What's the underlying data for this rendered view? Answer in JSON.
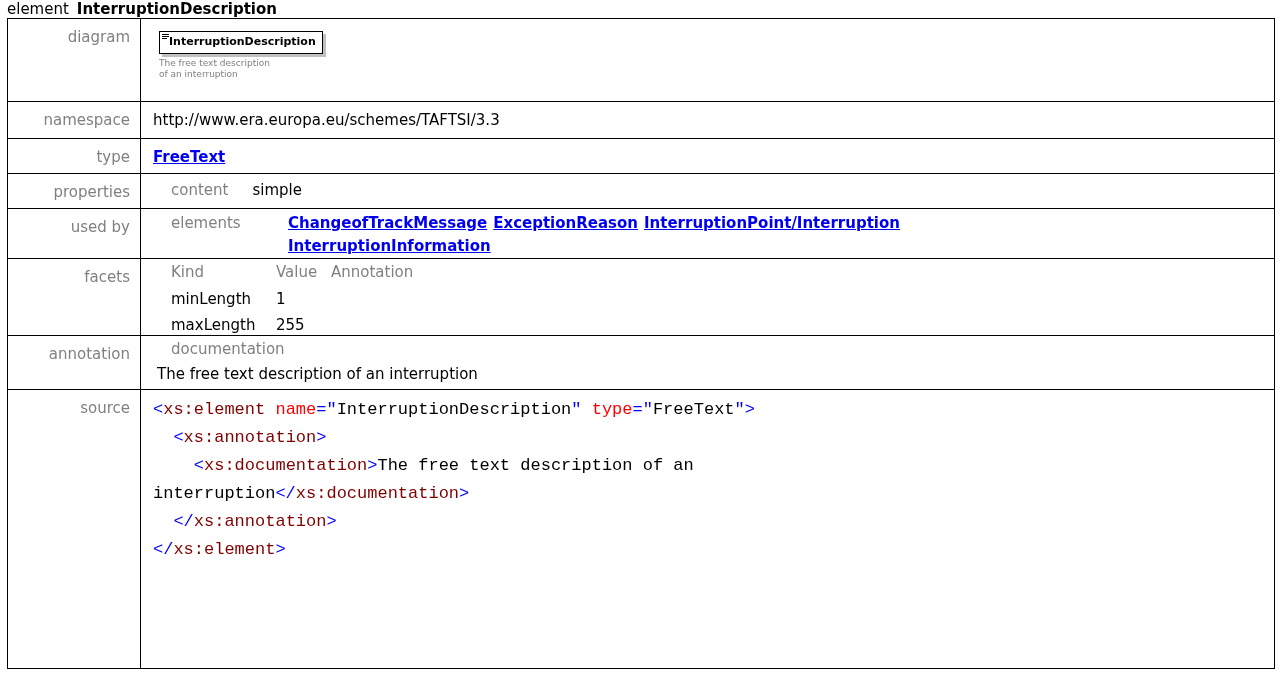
{
  "heading": {
    "prefix": "element",
    "name": "InterruptionDescription"
  },
  "diagram": {
    "label": "diagram",
    "element_name": "InterruptionDescription",
    "description": "The free text description of an interruption"
  },
  "namespace": {
    "label": "namespace",
    "value": "http://www.era.europa.eu/schemes/TAFTSI/3.3"
  },
  "type": {
    "label": "type",
    "link": "FreeText"
  },
  "properties": {
    "label": "properties",
    "key": "content",
    "value": "simple"
  },
  "used_by": {
    "label": "used by",
    "key": "elements",
    "links": [
      "ChangeofTrackMessage",
      "ExceptionReason",
      "InterruptionPoint/Interruption",
      "InterruptionInformation"
    ]
  },
  "facets": {
    "label": "facets",
    "columns": [
      "Kind",
      "Value",
      "Annotation"
    ],
    "rows": [
      {
        "kind": "minLength",
        "value": "1"
      },
      {
        "kind": "maxLength",
        "value": "255"
      }
    ]
  },
  "annotation": {
    "label": "annotation",
    "key": "documentation",
    "text": "The free text description of an interruption"
  },
  "source": {
    "label": "source",
    "lines": [
      [
        {
          "kind": "punct",
          "text": "<"
        },
        {
          "kind": "name",
          "text": "xs:element"
        },
        {
          "kind": "attr",
          "text": " name"
        },
        {
          "kind": "punct",
          "text": "=\""
        },
        {
          "kind": "text",
          "text": "InterruptionDescription"
        },
        {
          "kind": "punct",
          "text": "\""
        },
        {
          "kind": "attr",
          "text": " type"
        },
        {
          "kind": "punct",
          "text": "=\""
        },
        {
          "kind": "text",
          "text": "FreeText"
        },
        {
          "kind": "punct",
          "text": "\">"
        }
      ],
      [
        {
          "kind": "punct",
          "text": "  <"
        },
        {
          "kind": "name",
          "text": "xs:annotation"
        },
        {
          "kind": "punct",
          "text": ">"
        }
      ],
      [
        {
          "kind": "punct",
          "text": "    <"
        },
        {
          "kind": "name",
          "text": "xs:documentation"
        },
        {
          "kind": "punct",
          "text": ">"
        },
        {
          "kind": "text",
          "text": "The free text description of an"
        }
      ],
      [
        {
          "kind": "text",
          "text": "interruption"
        },
        {
          "kind": "punct",
          "text": "</"
        },
        {
          "kind": "name",
          "text": "xs:documentation"
        },
        {
          "kind": "punct",
          "text": ">"
        }
      ],
      [
        {
          "kind": "punct",
          "text": "  </"
        },
        {
          "kind": "name",
          "text": "xs:annotation"
        },
        {
          "kind": "punct",
          "text": ">"
        }
      ],
      [
        {
          "kind": "punct",
          "text": "</"
        },
        {
          "kind": "name",
          "text": "xs:element"
        },
        {
          "kind": "punct",
          "text": ">"
        }
      ]
    ]
  }
}
